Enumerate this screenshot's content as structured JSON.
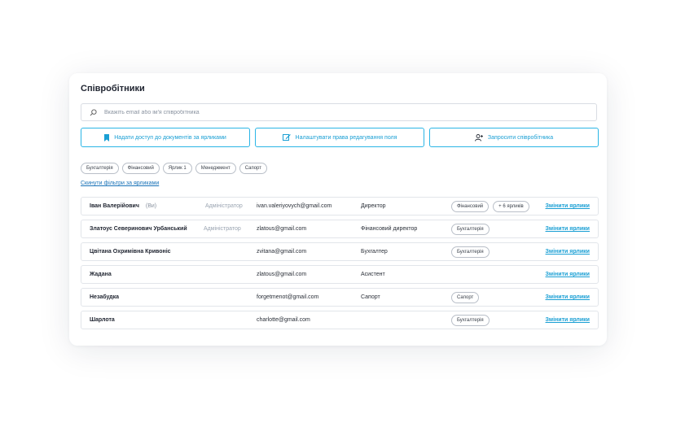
{
  "page": {
    "title": "Співробітники",
    "search": {
      "placeholder": "Вкажіть email або ім'я співробітника",
      "value": ""
    },
    "actions": [
      {
        "label": "Надати доступ до документів за ярликами",
        "icon": "bookmark-icon"
      },
      {
        "label": "Налаштувати права редагування поля",
        "icon": "edit-icon"
      },
      {
        "label": "Запросити співробітника",
        "icon": "add-user-icon"
      }
    ],
    "filter_chips": [
      "Бухгалтерія",
      "Фінансовий",
      "Ярлик 1",
      "Менеджмент",
      "Сапорт"
    ],
    "reset_filters": "Скинути фільтри за ярликами",
    "edit_label": "Змінити ярлики",
    "colors": {
      "accent": "#1a9fd4",
      "border": "#2ab5e6",
      "link": "#1a73b8"
    }
  },
  "employees": [
    {
      "name": "Іван Валерійович",
      "you": "(Ви)",
      "role": "Адміністратор",
      "email": "ivan.valeriyovych@gmail.com",
      "position": "Директор",
      "tags": [
        "Фінансовий",
        "+ 6 ярликів"
      ]
    },
    {
      "name": "Златоус Северинович Урбанський",
      "you": "",
      "role": "Адміністратор",
      "email": "zlatous@gmail.com",
      "position": "Фінансовий директор",
      "tags": [
        "Бухгалтерія"
      ]
    },
    {
      "name": "Цвітана Охримівна Кривоніс",
      "you": "",
      "role": "",
      "email": "zvitana@gmail.com",
      "position": "Бухгалтер",
      "tags": [
        "Бухгалтерія"
      ]
    },
    {
      "name": "Жадана",
      "you": "",
      "role": "",
      "email": "zlatous@gmail.com",
      "position": "Асистент",
      "tags": []
    },
    {
      "name": "Незабудка",
      "you": "",
      "role": "",
      "email": "forgetmenot@gmail.com",
      "position": "Сапорт",
      "tags": [
        "Сапорт"
      ]
    },
    {
      "name": "Шарлота",
      "you": "",
      "role": "",
      "email": "charlotte@gmail.com",
      "position": "",
      "tags": [
        "Бухгалтерія"
      ]
    }
  ]
}
